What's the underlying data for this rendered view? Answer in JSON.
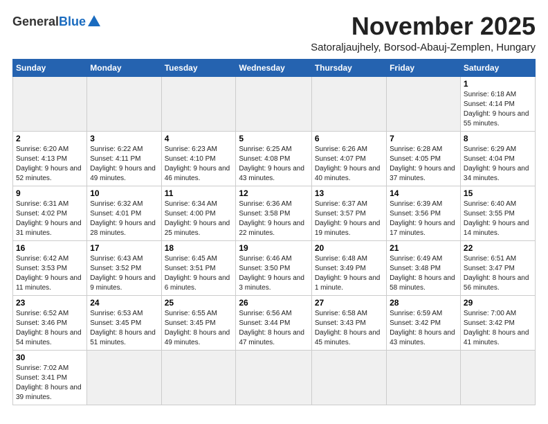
{
  "header": {
    "logo_general": "General",
    "logo_blue": "Blue",
    "month": "November 2025",
    "location": "Satoraljaujhely, Borsod-Abauj-Zemplen, Hungary"
  },
  "days_of_week": [
    "Sunday",
    "Monday",
    "Tuesday",
    "Wednesday",
    "Thursday",
    "Friday",
    "Saturday"
  ],
  "weeks": [
    [
      {
        "day": "",
        "info": ""
      },
      {
        "day": "",
        "info": ""
      },
      {
        "day": "",
        "info": ""
      },
      {
        "day": "",
        "info": ""
      },
      {
        "day": "",
        "info": ""
      },
      {
        "day": "",
        "info": ""
      },
      {
        "day": "1",
        "info": "Sunrise: 6:18 AM\nSunset: 4:14 PM\nDaylight: 9 hours and 55 minutes."
      }
    ],
    [
      {
        "day": "2",
        "info": "Sunrise: 6:20 AM\nSunset: 4:13 PM\nDaylight: 9 hours and 52 minutes."
      },
      {
        "day": "3",
        "info": "Sunrise: 6:22 AM\nSunset: 4:11 PM\nDaylight: 9 hours and 49 minutes."
      },
      {
        "day": "4",
        "info": "Sunrise: 6:23 AM\nSunset: 4:10 PM\nDaylight: 9 hours and 46 minutes."
      },
      {
        "day": "5",
        "info": "Sunrise: 6:25 AM\nSunset: 4:08 PM\nDaylight: 9 hours and 43 minutes."
      },
      {
        "day": "6",
        "info": "Sunrise: 6:26 AM\nSunset: 4:07 PM\nDaylight: 9 hours and 40 minutes."
      },
      {
        "day": "7",
        "info": "Sunrise: 6:28 AM\nSunset: 4:05 PM\nDaylight: 9 hours and 37 minutes."
      },
      {
        "day": "8",
        "info": "Sunrise: 6:29 AM\nSunset: 4:04 PM\nDaylight: 9 hours and 34 minutes."
      }
    ],
    [
      {
        "day": "9",
        "info": "Sunrise: 6:31 AM\nSunset: 4:02 PM\nDaylight: 9 hours and 31 minutes."
      },
      {
        "day": "10",
        "info": "Sunrise: 6:32 AM\nSunset: 4:01 PM\nDaylight: 9 hours and 28 minutes."
      },
      {
        "day": "11",
        "info": "Sunrise: 6:34 AM\nSunset: 4:00 PM\nDaylight: 9 hours and 25 minutes."
      },
      {
        "day": "12",
        "info": "Sunrise: 6:36 AM\nSunset: 3:58 PM\nDaylight: 9 hours and 22 minutes."
      },
      {
        "day": "13",
        "info": "Sunrise: 6:37 AM\nSunset: 3:57 PM\nDaylight: 9 hours and 19 minutes."
      },
      {
        "day": "14",
        "info": "Sunrise: 6:39 AM\nSunset: 3:56 PM\nDaylight: 9 hours and 17 minutes."
      },
      {
        "day": "15",
        "info": "Sunrise: 6:40 AM\nSunset: 3:55 PM\nDaylight: 9 hours and 14 minutes."
      }
    ],
    [
      {
        "day": "16",
        "info": "Sunrise: 6:42 AM\nSunset: 3:53 PM\nDaylight: 9 hours and 11 minutes."
      },
      {
        "day": "17",
        "info": "Sunrise: 6:43 AM\nSunset: 3:52 PM\nDaylight: 9 hours and 9 minutes."
      },
      {
        "day": "18",
        "info": "Sunrise: 6:45 AM\nSunset: 3:51 PM\nDaylight: 9 hours and 6 minutes."
      },
      {
        "day": "19",
        "info": "Sunrise: 6:46 AM\nSunset: 3:50 PM\nDaylight: 9 hours and 3 minutes."
      },
      {
        "day": "20",
        "info": "Sunrise: 6:48 AM\nSunset: 3:49 PM\nDaylight: 9 hours and 1 minute."
      },
      {
        "day": "21",
        "info": "Sunrise: 6:49 AM\nSunset: 3:48 PM\nDaylight: 8 hours and 58 minutes."
      },
      {
        "day": "22",
        "info": "Sunrise: 6:51 AM\nSunset: 3:47 PM\nDaylight: 8 hours and 56 minutes."
      }
    ],
    [
      {
        "day": "23",
        "info": "Sunrise: 6:52 AM\nSunset: 3:46 PM\nDaylight: 8 hours and 54 minutes."
      },
      {
        "day": "24",
        "info": "Sunrise: 6:53 AM\nSunset: 3:45 PM\nDaylight: 8 hours and 51 minutes."
      },
      {
        "day": "25",
        "info": "Sunrise: 6:55 AM\nSunset: 3:45 PM\nDaylight: 8 hours and 49 minutes."
      },
      {
        "day": "26",
        "info": "Sunrise: 6:56 AM\nSunset: 3:44 PM\nDaylight: 8 hours and 47 minutes."
      },
      {
        "day": "27",
        "info": "Sunrise: 6:58 AM\nSunset: 3:43 PM\nDaylight: 8 hours and 45 minutes."
      },
      {
        "day": "28",
        "info": "Sunrise: 6:59 AM\nSunset: 3:42 PM\nDaylight: 8 hours and 43 minutes."
      },
      {
        "day": "29",
        "info": "Sunrise: 7:00 AM\nSunset: 3:42 PM\nDaylight: 8 hours and 41 minutes."
      }
    ],
    [
      {
        "day": "30",
        "info": "Sunrise: 7:02 AM\nSunset: 3:41 PM\nDaylight: 8 hours and 39 minutes."
      },
      {
        "day": "",
        "info": ""
      },
      {
        "day": "",
        "info": ""
      },
      {
        "day": "",
        "info": ""
      },
      {
        "day": "",
        "info": ""
      },
      {
        "day": "",
        "info": ""
      },
      {
        "day": "",
        "info": ""
      }
    ]
  ]
}
